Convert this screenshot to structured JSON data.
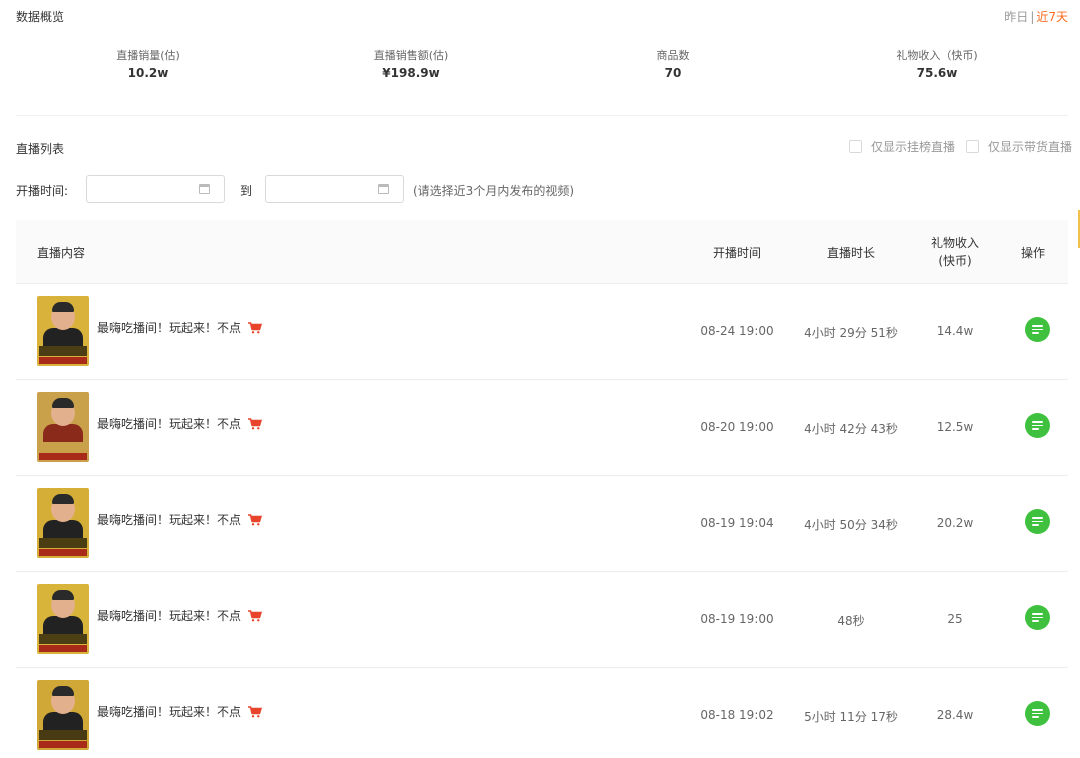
{
  "overview": {
    "title": "数据概览",
    "range_yesterday": "昨日",
    "range_separator": "|",
    "range_7days": "近7天"
  },
  "stats": [
    {
      "label": "直播销量(估)",
      "value": "10.2w"
    },
    {
      "label": "直播销售额(估)",
      "value": "¥198.9w"
    },
    {
      "label": "商品数",
      "value": "70"
    },
    {
      "label": "礼物收入（快币)",
      "value": "75.6w"
    }
  ],
  "live_list": {
    "title": "直播列表",
    "filter_ranked": "仅显示挂榜直播",
    "filter_selling": "仅显示带货直播"
  },
  "date_filter": {
    "label": "开播时间:",
    "to_label": "到",
    "hint": "(请选择近3个月内发布的视频)",
    "start_value": "",
    "end_value": ""
  },
  "table": {
    "headers": {
      "content": "直播内容",
      "start_time": "开播时间",
      "duration": "直播时长",
      "gift_line1": "礼物收入",
      "gift_line2": "(快币)",
      "action": "操作"
    },
    "rows": [
      {
        "title": "最嗨吃播间！玩起来！不点",
        "start_time": "08-24 19:00",
        "duration": "4小时 29分 51秒",
        "gift": "14.4w"
      },
      {
        "title": "最嗨吃播间！玩起来！不点",
        "start_time": "08-20 19:00",
        "duration": "4小时 42分 43秒",
        "gift": "12.5w"
      },
      {
        "title": "最嗨吃播间！玩起来！不点",
        "start_time": "08-19 19:04",
        "duration": "4小时 50分 34秒",
        "gift": "20.2w"
      },
      {
        "title": "最嗨吃播间！玩起来！不点",
        "start_time": "08-19 19:00",
        "duration": "48秒",
        "gift": "25"
      },
      {
        "title": "最嗨吃播间！玩起来！不点",
        "start_time": "08-18 19:02",
        "duration": "5小时 11分 17秒",
        "gift": "28.4w"
      }
    ]
  },
  "colors": {
    "accent_orange": "#fa6b1f",
    "action_green": "#3fc13f",
    "cart_red": "#e8452c"
  },
  "icons": {
    "calendar": "calendar-icon",
    "cart": "shopping-cart-icon",
    "detail": "list-detail-icon"
  }
}
